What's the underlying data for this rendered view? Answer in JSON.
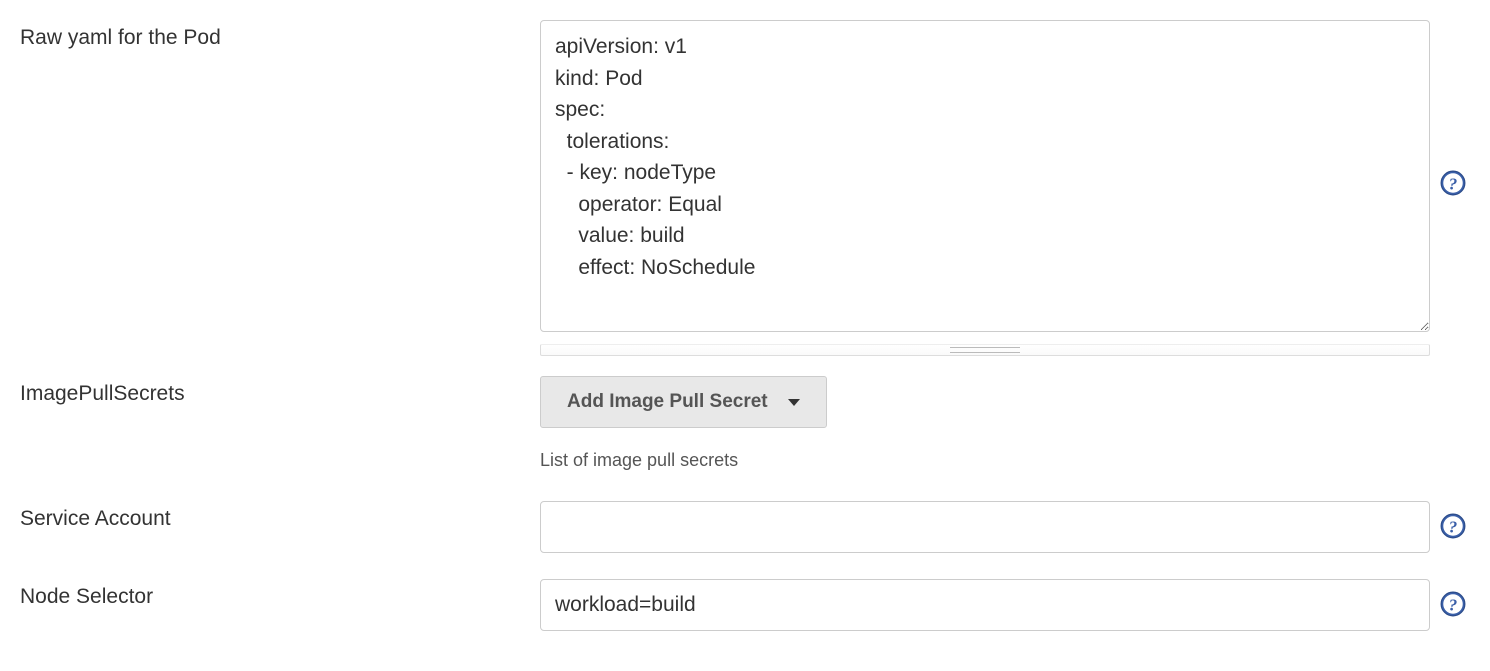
{
  "rawYaml": {
    "label": "Raw yaml for the Pod",
    "value": "apiVersion: v1\nkind: Pod\nspec:\n  tolerations:\n  - key: nodeType\n    operator: Equal\n    value: build\n    effect: NoSchedule"
  },
  "imagePullSecrets": {
    "label": "ImagePullSecrets",
    "buttonLabel": "Add Image Pull Secret",
    "helpText": "List of image pull secrets"
  },
  "serviceAccount": {
    "label": "Service Account",
    "value": ""
  },
  "nodeSelector": {
    "label": "Node Selector",
    "value": "workload=build"
  }
}
